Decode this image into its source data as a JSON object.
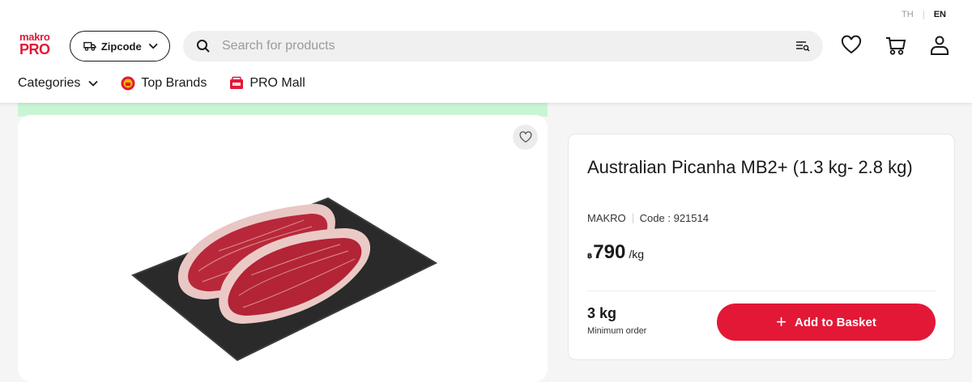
{
  "language": {
    "th": "TH",
    "en": "EN"
  },
  "logo": {
    "line1": "makro",
    "line2": "PRO"
  },
  "zipcode": {
    "label": "Zipcode"
  },
  "search": {
    "placeholder": "Search for products"
  },
  "nav": {
    "categories": "Categories",
    "top_brands": "Top Brands",
    "pro_mall": "PRO Mall"
  },
  "product": {
    "title": "Australian Picanha MB2+ (1.3 kg- 2.8 kg)",
    "brand": "MAKRO",
    "code": "Code : 921514",
    "currency": "฿",
    "price": "790",
    "unit": "/kg",
    "min_qty": "3 kg",
    "min_label": "Minimum order",
    "add_label": "Add to Basket"
  },
  "colors": {
    "brand_red": "#e31837",
    "promo_green": "#c9f5d4"
  },
  "icons": [
    "truck-icon",
    "chevron-down-icon",
    "search-icon",
    "filter-icon",
    "heart-icon",
    "cart-icon",
    "user-icon",
    "plus-icon"
  ]
}
